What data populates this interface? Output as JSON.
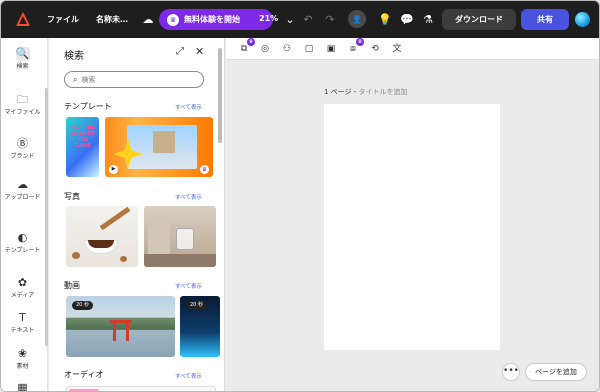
{
  "topbar": {
    "file_label": "ファイル",
    "design_name": "名称未…",
    "trial_label": "無料体験を開始",
    "zoom": "21%",
    "download_label": "ダウンロード",
    "share_label": "共有"
  },
  "rail": {
    "items": [
      {
        "label": "検索",
        "icon": "search-icon"
      },
      {
        "label": "マイファイル",
        "icon": "folder-icon"
      },
      {
        "label": "ブランド",
        "icon": "brand-icon"
      },
      {
        "label": "アップロード",
        "icon": "upload-icon"
      },
      {
        "label": "テンプレート",
        "icon": "template-icon"
      },
      {
        "label": "メディア",
        "icon": "media-icon"
      },
      {
        "label": "テキスト",
        "icon": "text-icon"
      },
      {
        "label": "素材",
        "icon": "elements-icon"
      }
    ]
  },
  "panel": {
    "title": "検索",
    "search_placeholder": "検索",
    "sections": {
      "templates": {
        "title": "テンプレート",
        "more": "すべて表示"
      },
      "photos": {
        "title": "写真",
        "more": "すべて表示"
      },
      "videos": {
        "title": "動画",
        "more": "すべて表示"
      },
      "audio": {
        "title": "オーディオ",
        "more": "すべて表示"
      }
    },
    "template_card_text": "FOR THE LOVE OF THE GAME",
    "video_badges": [
      "20 秒",
      "20 秒"
    ]
  },
  "canvas": {
    "page_number": "1 ページ - ",
    "page_title_placeholder": "タイトルを追加",
    "add_page_label": "ページを追加",
    "more_label": "•••"
  },
  "colors": {
    "accent": "#7d2ae8",
    "share": "#4a53e0",
    "topbar": "#1e1e1e"
  }
}
